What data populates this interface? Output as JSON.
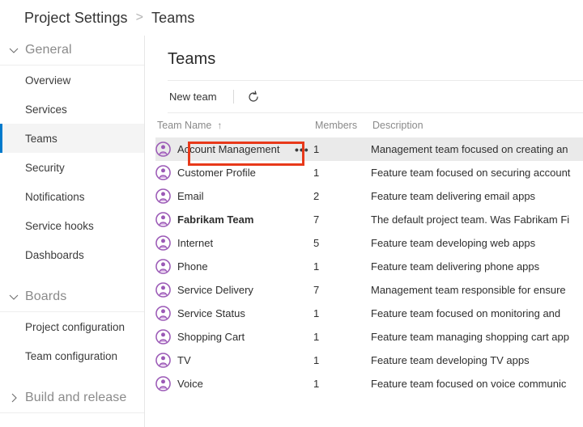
{
  "breadcrumb": {
    "root": "Project Settings",
    "separator": ">",
    "current": "Teams"
  },
  "sidebar": {
    "groups": [
      {
        "label": "General",
        "expanded": true,
        "chevron": "chevron-down-icon",
        "items": [
          {
            "label": "Overview",
            "selected": false
          },
          {
            "label": "Services",
            "selected": false
          },
          {
            "label": "Teams",
            "selected": true
          },
          {
            "label": "Security",
            "selected": false
          },
          {
            "label": "Notifications",
            "selected": false
          },
          {
            "label": "Service hooks",
            "selected": false
          },
          {
            "label": "Dashboards",
            "selected": false
          }
        ]
      },
      {
        "label": "Boards",
        "expanded": true,
        "chevron": "chevron-down-icon",
        "items": [
          {
            "label": "Project configuration",
            "selected": false
          },
          {
            "label": "Team configuration",
            "selected": false
          }
        ]
      },
      {
        "label": "Build and release",
        "expanded": false,
        "chevron": "chevron-right-icon",
        "items": []
      }
    ]
  },
  "main": {
    "title": "Teams",
    "toolbar": {
      "new_team_label": "New team",
      "refresh_icon": "refresh-icon",
      "refresh_title": "Refresh"
    },
    "table": {
      "columns": [
        {
          "key": "name",
          "label": "Team Name",
          "sort": "ascending",
          "sort_glyph": "↑"
        },
        {
          "key": "members",
          "label": "Members",
          "sort": "none",
          "sort_glyph": ""
        },
        {
          "key": "description",
          "label": "Description",
          "sort": "none",
          "sort_glyph": ""
        }
      ],
      "rows": [
        {
          "name": "Account Management",
          "members": "1",
          "description": "Management team focused on creating an",
          "bold": false,
          "active": true,
          "has_overflow": true,
          "overflow_label": "•••",
          "icon": "team-avatar-icon"
        },
        {
          "name": "Customer Profile",
          "members": "1",
          "description": "Feature team focused on securing account",
          "bold": false,
          "active": false,
          "has_overflow": false,
          "overflow_label": "",
          "icon": "team-avatar-icon"
        },
        {
          "name": "Email",
          "members": "2",
          "description": "Feature team delivering email apps",
          "bold": false,
          "active": false,
          "has_overflow": false,
          "overflow_label": "",
          "icon": "team-avatar-icon"
        },
        {
          "name": "Fabrikam Team",
          "members": "7",
          "description": "The default project team. Was Fabrikam Fi",
          "bold": true,
          "active": false,
          "has_overflow": false,
          "overflow_label": "",
          "icon": "team-avatar-icon"
        },
        {
          "name": "Internet",
          "members": "5",
          "description": "Feature team developing web apps",
          "bold": false,
          "active": false,
          "has_overflow": false,
          "overflow_label": "",
          "icon": "team-avatar-icon"
        },
        {
          "name": "Phone",
          "members": "1",
          "description": "Feature team delivering phone apps",
          "bold": false,
          "active": false,
          "has_overflow": false,
          "overflow_label": "",
          "icon": "team-avatar-icon"
        },
        {
          "name": "Service Delivery",
          "members": "7",
          "description": "Management team responsible for ensure",
          "bold": false,
          "active": false,
          "has_overflow": false,
          "overflow_label": "",
          "icon": "team-avatar-icon"
        },
        {
          "name": "Service Status",
          "members": "1",
          "description": "Feature team focused on monitoring and ",
          "bold": false,
          "active": false,
          "has_overflow": false,
          "overflow_label": "",
          "icon": "team-avatar-icon"
        },
        {
          "name": "Shopping Cart",
          "members": "1",
          "description": "Feature team managing shopping cart app",
          "bold": false,
          "active": false,
          "has_overflow": false,
          "overflow_label": "",
          "icon": "team-avatar-icon"
        },
        {
          "name": "TV",
          "members": "1",
          "description": "Feature team developing TV apps",
          "bold": false,
          "active": false,
          "has_overflow": false,
          "overflow_label": "",
          "icon": "team-avatar-icon"
        },
        {
          "name": "Voice",
          "members": "1",
          "description": "Feature team focused on voice communic",
          "bold": false,
          "active": false,
          "has_overflow": false,
          "overflow_label": "",
          "icon": "team-avatar-icon"
        }
      ]
    }
  },
  "annotation": {
    "type": "highlight-rectangle",
    "target": "Account Management",
    "color": "#e8391a"
  },
  "colors": {
    "accent": "#007acc",
    "avatar_purple": "#9b59b6",
    "annotation_red": "#e8391a",
    "selected_row": "#eaeaea",
    "selected_nav": "#f4f4f4"
  }
}
